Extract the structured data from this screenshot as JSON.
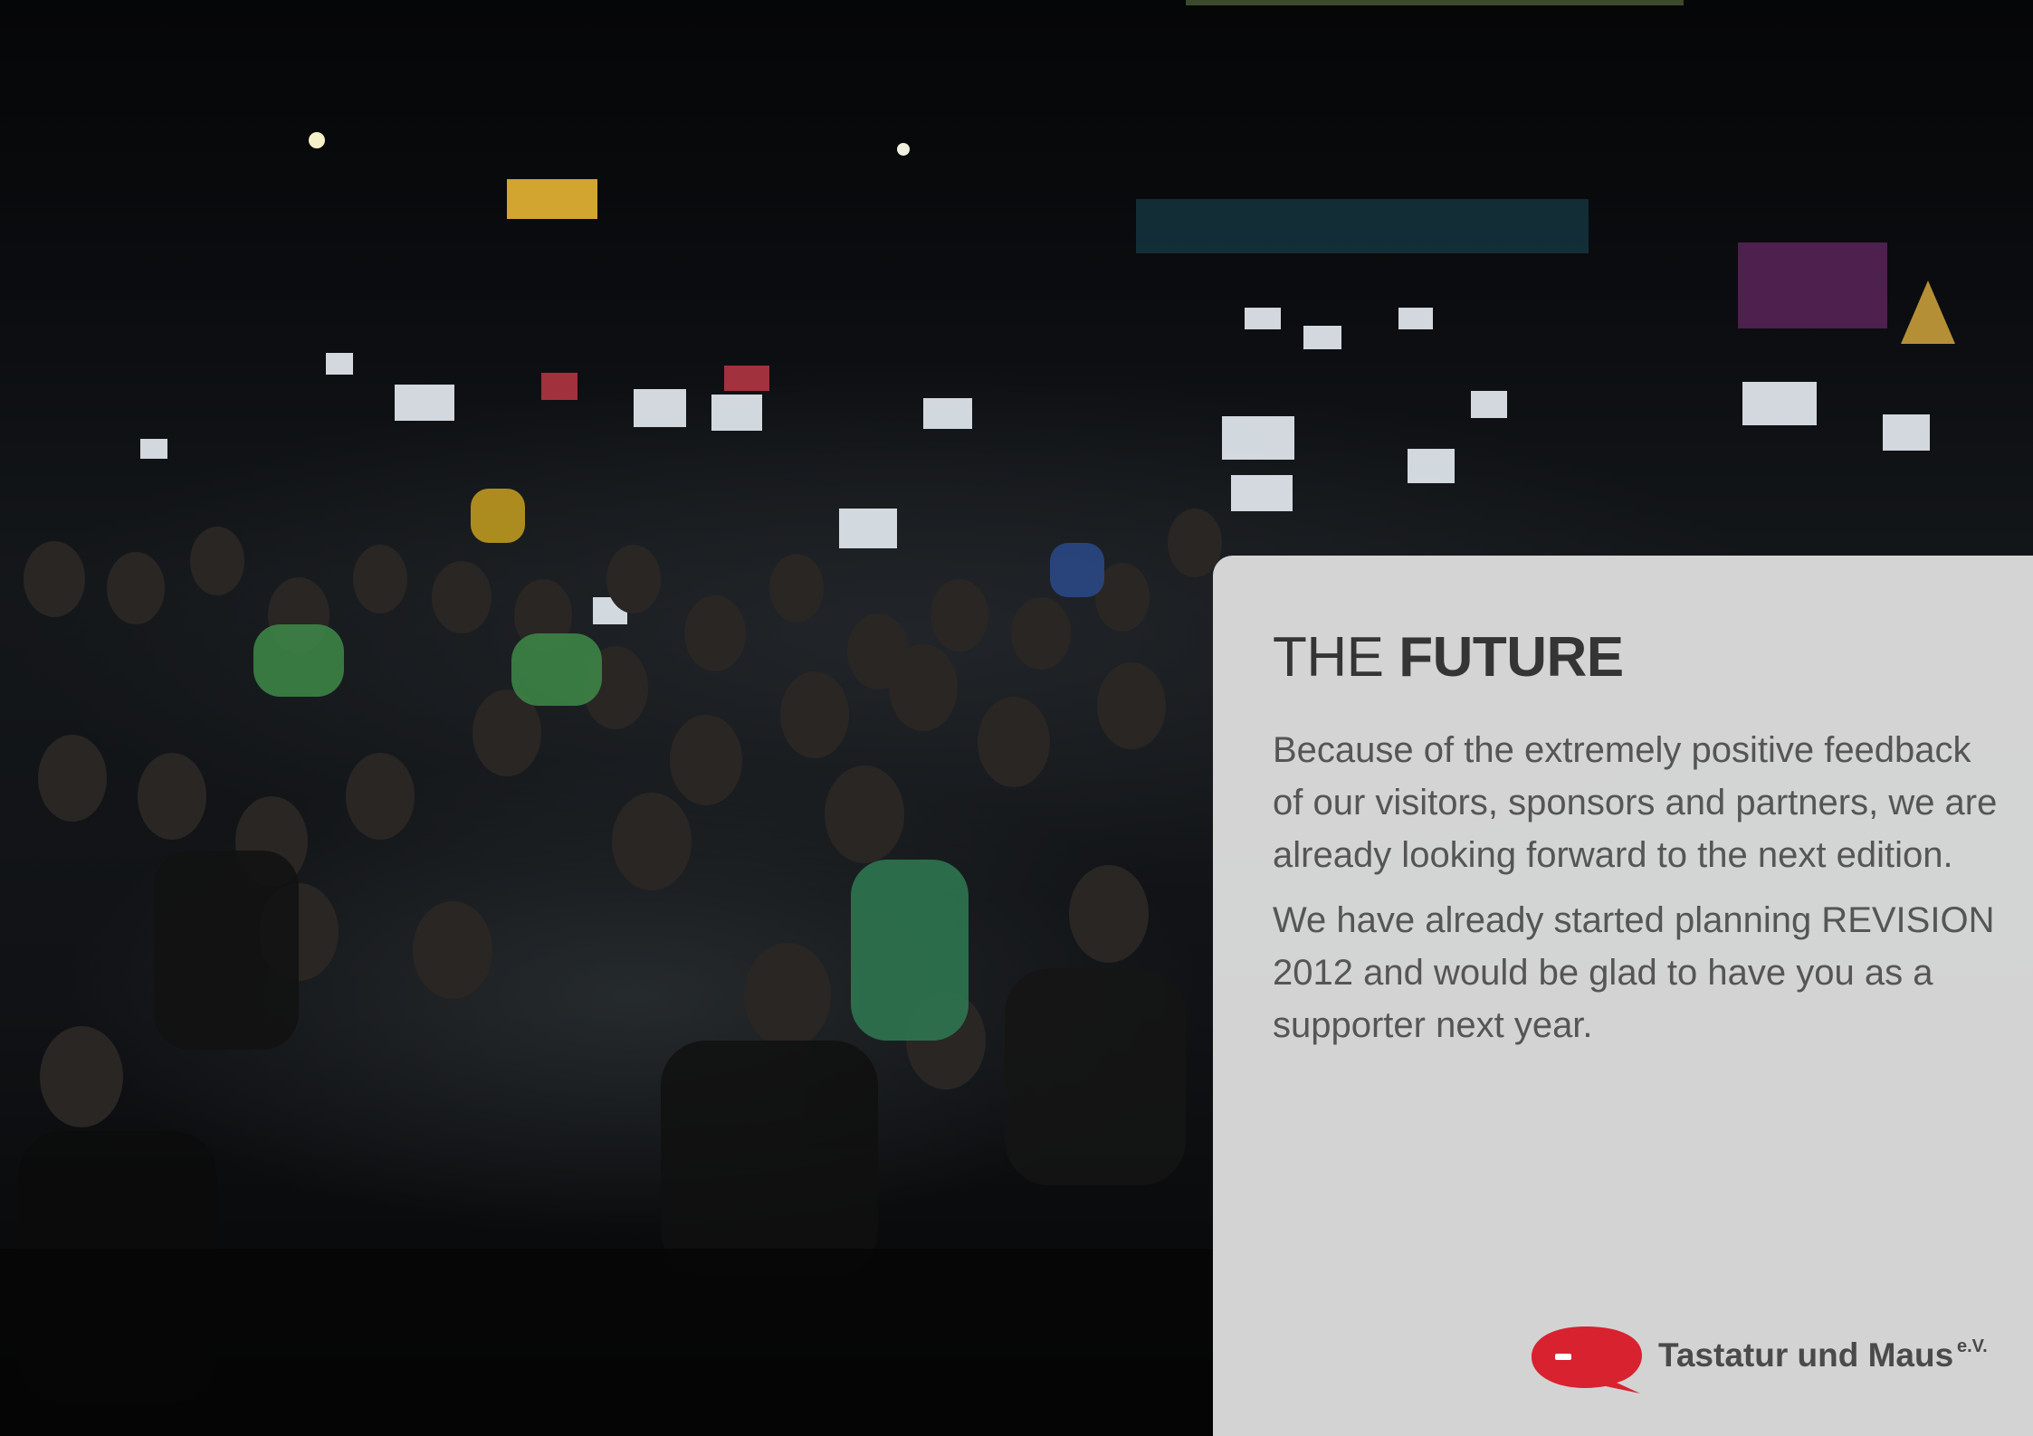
{
  "page": {
    "title_light": "THE ",
    "title_bold": "FUTURE",
    "paragraphs": [
      "Because of the extremely positive feedback of our visitors, sponsors and partners, we are already looking forward to the next edition.",
      "We have already started planning REVISION 2012 and would be glad to have you as a supporter next year."
    ]
  },
  "logo": {
    "name": "Tastatur und Maus",
    "suffix": "e.V.",
    "accent_color": "#d8222f"
  },
  "photo": {
    "icon": "audience-crowd-photo"
  }
}
